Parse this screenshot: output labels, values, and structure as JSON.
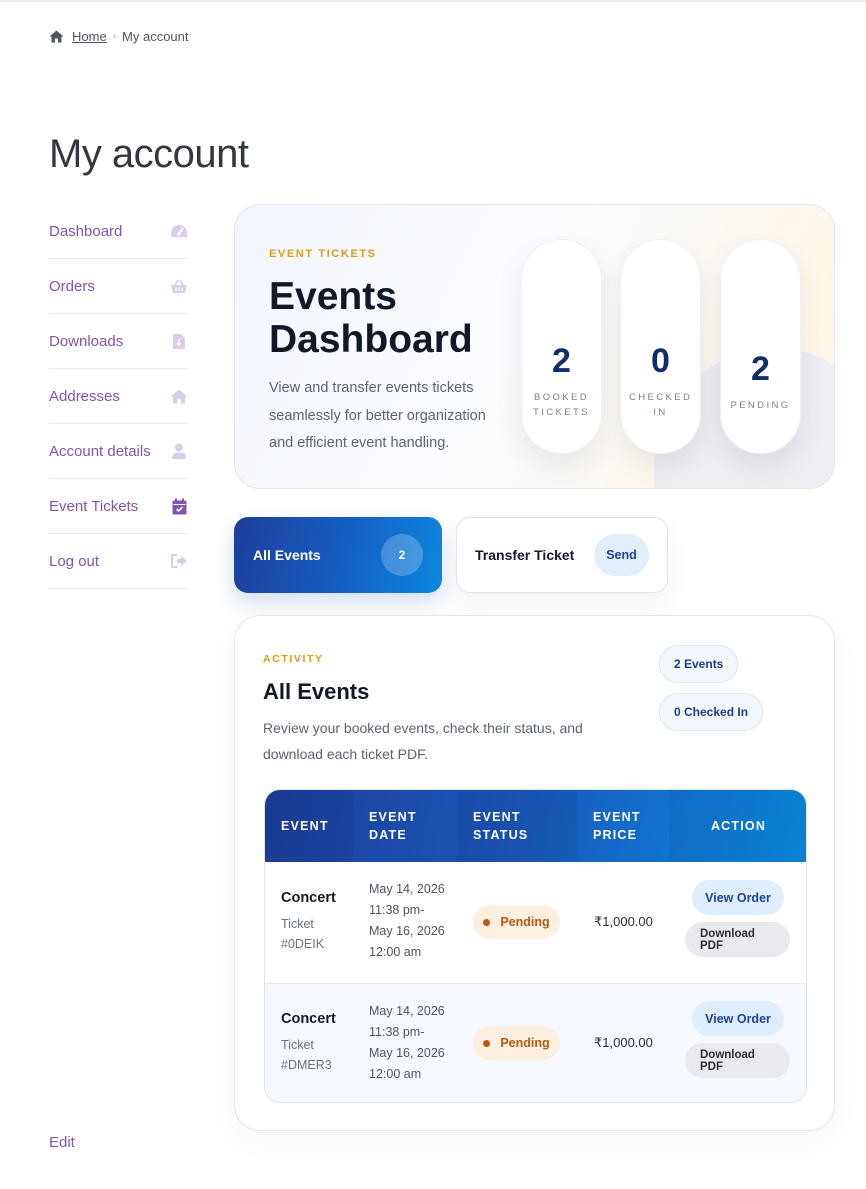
{
  "breadcrumb": {
    "home": "Home",
    "separator": "›",
    "current": "My account",
    "home_icon": "home-icon"
  },
  "page_title": "My account",
  "sidebar": {
    "items": [
      {
        "label": "Dashboard",
        "icon": "dashboard-gauge-icon"
      },
      {
        "label": "Orders",
        "icon": "basket-icon"
      },
      {
        "label": "Downloads",
        "icon": "file-download-icon"
      },
      {
        "label": "Addresses",
        "icon": "home-icon"
      },
      {
        "label": "Account details",
        "icon": "user-icon"
      },
      {
        "label": "Event Tickets",
        "icon": "calendar-check-icon",
        "active": true
      },
      {
        "label": "Log out",
        "icon": "sign-out-icon"
      }
    ],
    "edit_label": "Edit"
  },
  "hero": {
    "eyebrow": "EVENT TICKETS",
    "title": "Events Dashboard",
    "description": "View and transfer events tickets seamlessly for better organization and efficient event handling.",
    "stats": [
      {
        "value": "2",
        "label": "BOOKED TICKETS"
      },
      {
        "value": "0",
        "label": "CHECKED IN"
      },
      {
        "value": "2",
        "label": "PENDING"
      }
    ]
  },
  "tabs": {
    "all_events": {
      "label": "All Events",
      "count": "2"
    },
    "transfer": {
      "label": "Transfer Ticket",
      "action": "Send"
    }
  },
  "activity": {
    "eyebrow": "ACTIVITY",
    "title": "All Events",
    "description": "Review your booked events, check their status, and download each ticket PDF.",
    "chips": [
      "2 Events",
      "0 Checked In"
    ],
    "columns": [
      "EVENT",
      "EVENT DATE",
      "EVENT STATUS",
      "EVENT PRICE",
      "ACTION"
    ],
    "rows": [
      {
        "event": "Concert",
        "ticket": "Ticket #0DEIK",
        "date": "May 14, 2026 11:38 pm- May 16, 2026 12:00 am",
        "status": "Pending",
        "price": "₹1,000.00",
        "view": "View Order",
        "download": "Download PDF"
      },
      {
        "event": "Concert",
        "ticket": "Ticket #DMER3",
        "date": "May 14, 2026 11:38 pm- May 16, 2026 12:00 am",
        "status": "Pending",
        "price": "₹1,000.00",
        "view": "View Order",
        "download": "Download PDF"
      }
    ]
  },
  "colors": {
    "accent_purple": "#7f54b3",
    "eyebrow_orange": "#e39a1c",
    "navy": "#122c6b",
    "blue_start": "#1d3e9a",
    "blue_end": "#0a8be2",
    "pending": "#b55a12"
  }
}
